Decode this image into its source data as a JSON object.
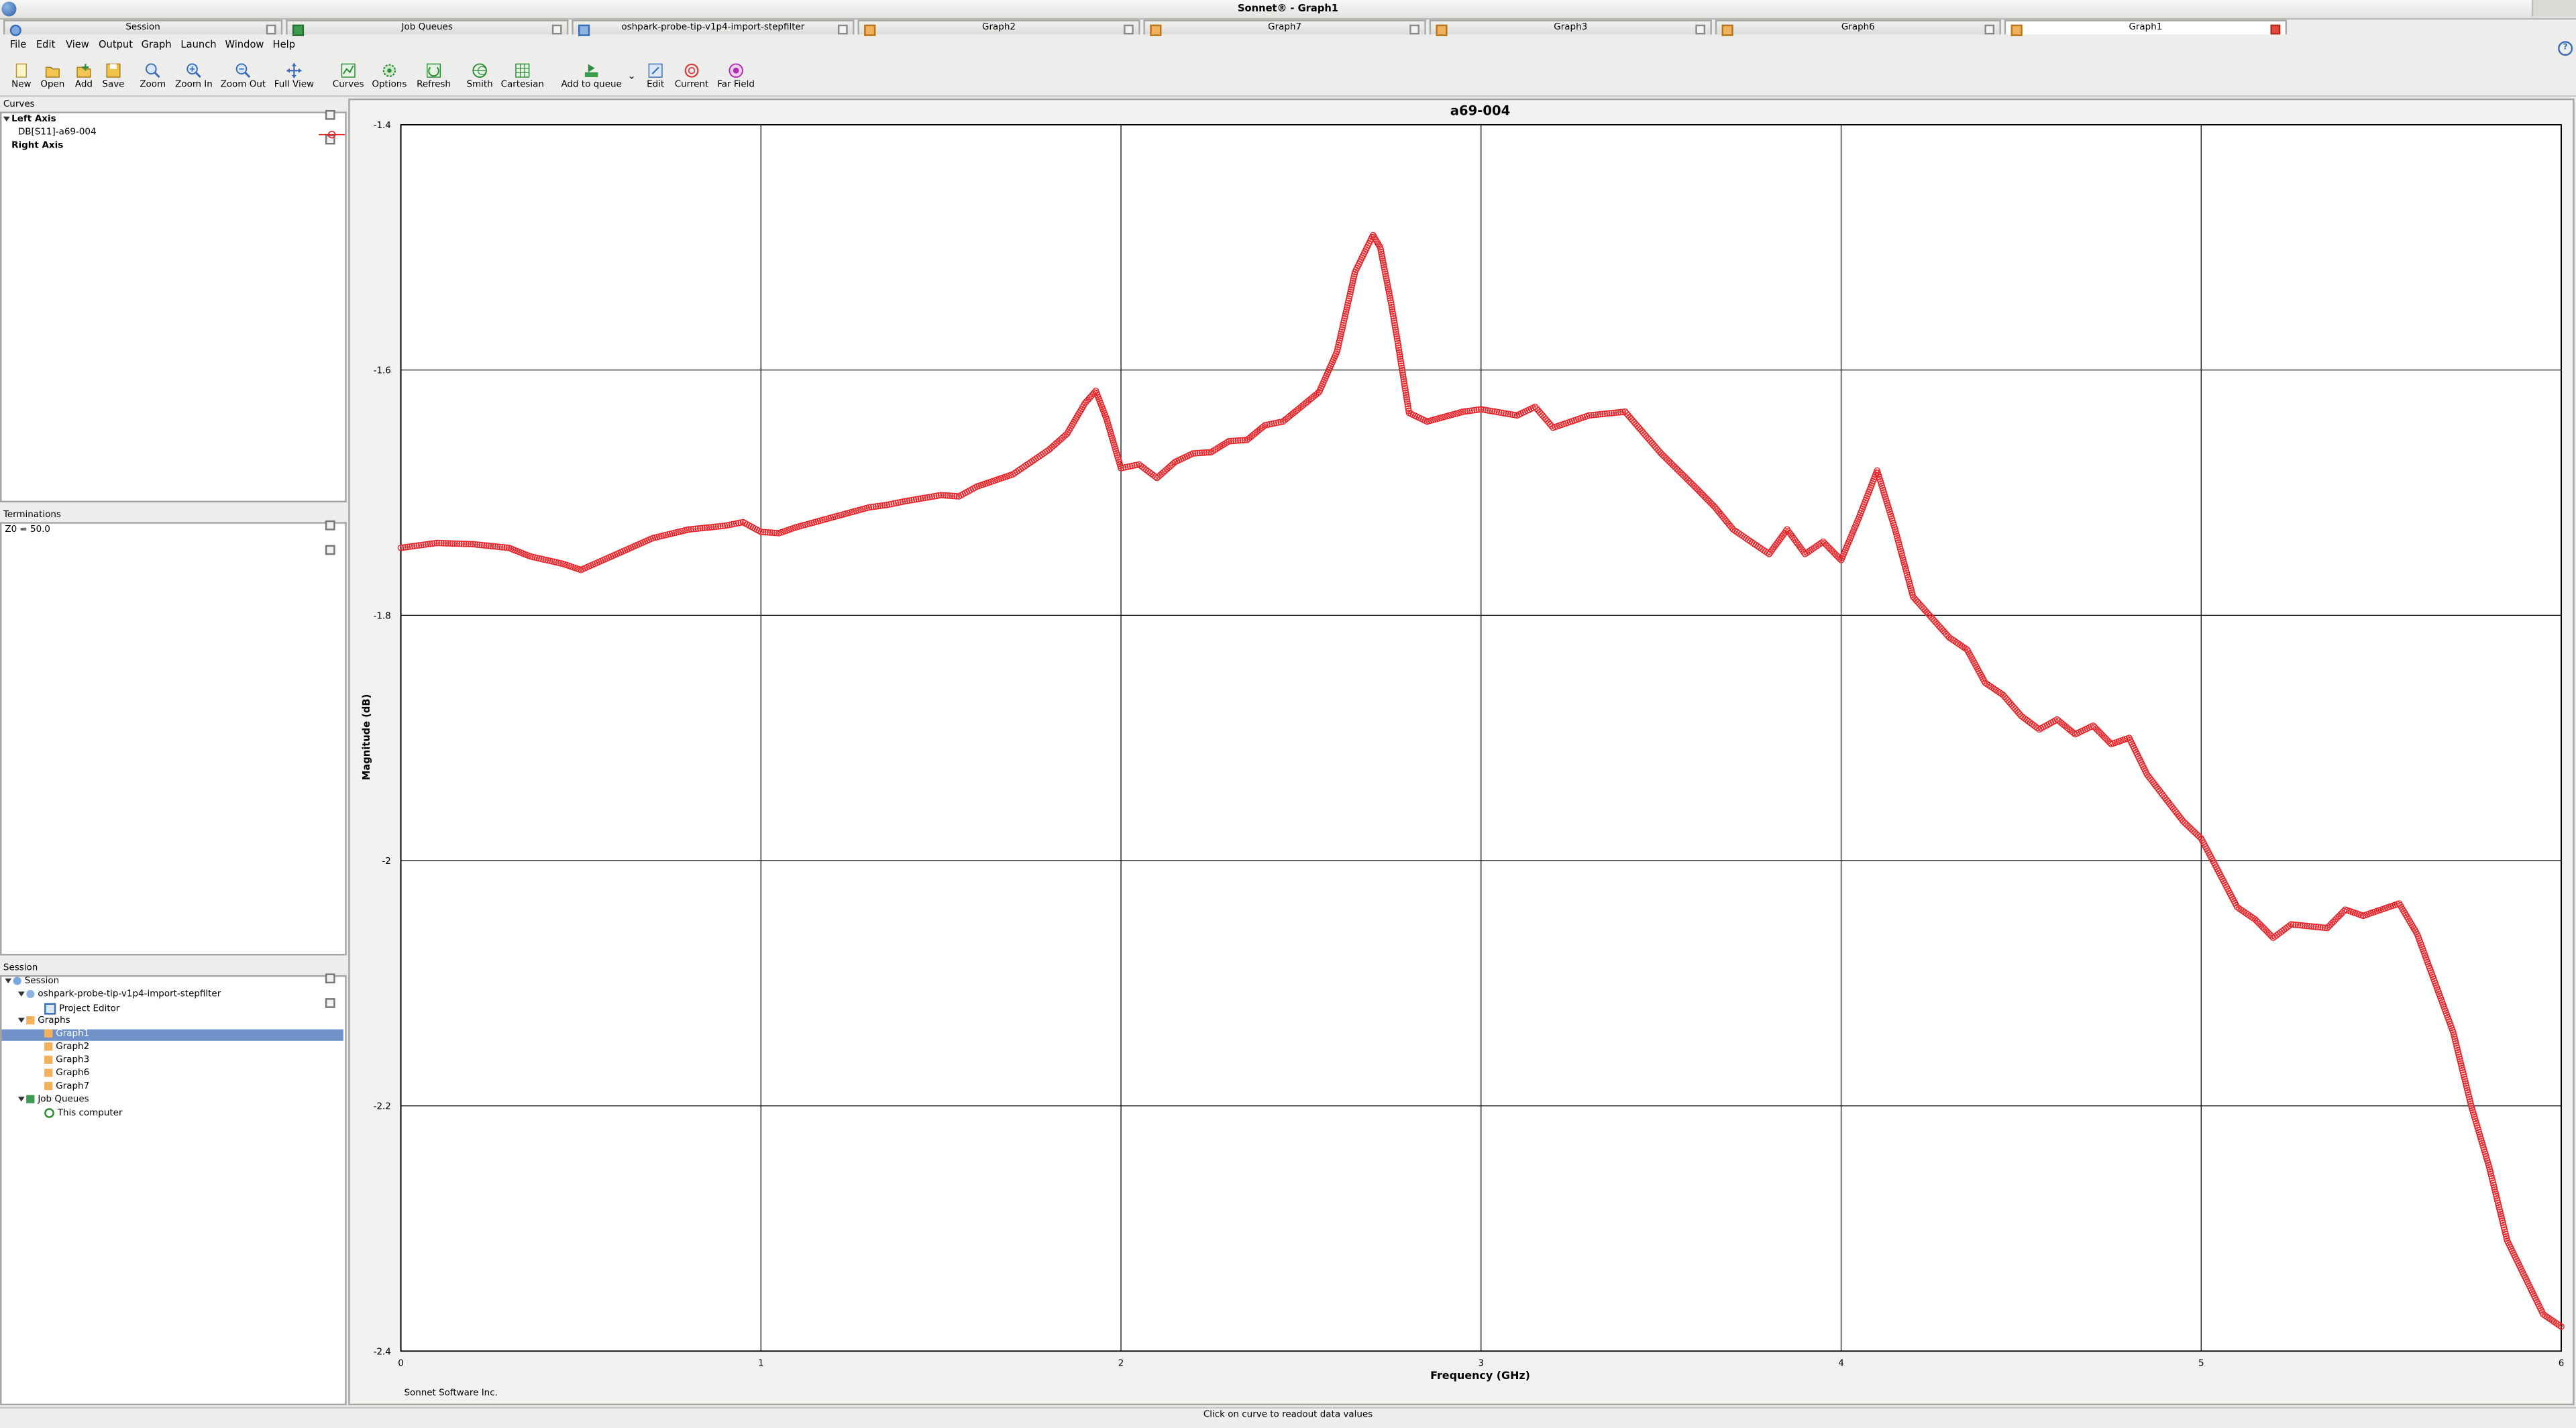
{
  "window": {
    "title": "Sonnet® - Graph1"
  },
  "tabs": [
    {
      "label": "Session",
      "active": false
    },
    {
      "label": "Job Queues",
      "active": false
    },
    {
      "label": "oshpark-probe-tip-v1p4-import-stepfilter",
      "active": false
    },
    {
      "label": "Graph2",
      "active": false
    },
    {
      "label": "Graph7",
      "active": false
    },
    {
      "label": "Graph3",
      "active": false
    },
    {
      "label": "Graph6",
      "active": false
    },
    {
      "label": "Graph1",
      "active": true
    }
  ],
  "menu": [
    "File",
    "Edit",
    "View",
    "Output",
    "Graph",
    "Launch",
    "Window",
    "Help"
  ],
  "toolbar": [
    {
      "label": "New",
      "icon": "new-icon"
    },
    {
      "label": "Open",
      "icon": "open-icon"
    },
    {
      "label": "Add",
      "icon": "add-icon"
    },
    {
      "label": "Save",
      "icon": "save-icon"
    },
    {
      "label": "Zoom",
      "icon": "zoom-icon"
    },
    {
      "label": "Zoom In",
      "icon": "zoom-in-icon"
    },
    {
      "label": "Zoom Out",
      "icon": "zoom-out-icon"
    },
    {
      "label": "Full View",
      "icon": "full-view-icon"
    },
    {
      "label": "Curves",
      "icon": "curves-icon"
    },
    {
      "label": "Options",
      "icon": "options-icon"
    },
    {
      "label": "Refresh",
      "icon": "refresh-icon"
    },
    {
      "label": "Smith",
      "icon": "smith-icon"
    },
    {
      "label": "Cartesian",
      "icon": "cartesian-icon"
    },
    {
      "label": "Add to queue",
      "icon": "add-to-queue-icon"
    },
    {
      "label": "Edit",
      "icon": "edit-icon"
    },
    {
      "label": "Current",
      "icon": "current-icon"
    },
    {
      "label": "Far Field",
      "icon": "far-field-icon"
    }
  ],
  "curves_panel": {
    "title": "Curves",
    "left_axis": "Left Axis",
    "curve": "DB[S11]-a69-004",
    "right_axis": "Right Axis"
  },
  "terminations_panel": {
    "title": "Terminations",
    "value": "Z0 = 50.0"
  },
  "session_panel": {
    "title": "Session",
    "root": "Session",
    "project": "oshpark-probe-tip-v1p4-import-stepfilter",
    "project_editor": "Project Editor",
    "graphs": "Graphs",
    "graph_items": [
      "Graph1",
      "Graph2",
      "Graph3",
      "Graph6",
      "Graph7"
    ],
    "selected": "Graph1",
    "job_queues": "Job Queues",
    "this_computer": "This computer"
  },
  "graph": {
    "footer": "Sonnet Software Inc."
  },
  "status": {
    "text": "Click on curve to readout data values"
  },
  "colors": {
    "curve": "#e8262b",
    "selection": "#7192c8"
  },
  "chart_data": {
    "type": "scatter",
    "title": "a69-004",
    "xlabel": "Frequency (GHz)",
    "ylabel": "Magnitude (dB)",
    "xlim": [
      0,
      6
    ],
    "ylim": [
      -2.4,
      -1.4
    ],
    "xticks": [
      "0",
      "1",
      "2",
      "3",
      "4",
      "5",
      "6"
    ],
    "yticks": [
      "-1.4",
      "-1.6",
      "-1.8",
      "-2",
      "-2.2",
      "-2.4"
    ],
    "grid": true,
    "series": [
      {
        "name": "DB[S11]-a69-004",
        "x": [
          0,
          0.1,
          0.2,
          0.3,
          0.36,
          0.45,
          0.5,
          0.6,
          0.7,
          0.8,
          0.9,
          0.95,
          1.0,
          1.05,
          1.1,
          1.2,
          1.3,
          1.35,
          1.4,
          1.5,
          1.55,
          1.6,
          1.65,
          1.7,
          1.8,
          1.85,
          1.9,
          1.93,
          1.96,
          2.0,
          2.05,
          2.1,
          2.15,
          2.2,
          2.25,
          2.3,
          2.35,
          2.4,
          2.45,
          2.5,
          2.55,
          2.6,
          2.65,
          2.7,
          2.72,
          2.75,
          2.77,
          2.8,
          2.85,
          2.9,
          2.95,
          3.0,
          3.1,
          3.15,
          3.2,
          3.3,
          3.4,
          3.5,
          3.6,
          3.65,
          3.7,
          3.8,
          3.85,
          3.9,
          3.95,
          4.0,
          4.05,
          4.1,
          4.15,
          4.2,
          4.3,
          4.35,
          4.4,
          4.45,
          4.5,
          4.55,
          4.6,
          4.65,
          4.7,
          4.75,
          4.8,
          4.85,
          4.95,
          5.0,
          5.05,
          5.1,
          5.15,
          5.2,
          5.25,
          5.35,
          5.4,
          5.45,
          5.5,
          5.55,
          5.6,
          5.65,
          5.7,
          5.75,
          5.8,
          5.85,
          5.9,
          5.95,
          6.0
        ],
        "y": [
          -1.745,
          -1.741,
          -1.742,
          -1.745,
          -1.752,
          -1.758,
          -1.763,
          -1.75,
          -1.737,
          -1.73,
          -1.727,
          -1.724,
          -1.732,
          -1.733,
          -1.728,
          -1.72,
          -1.712,
          -1.71,
          -1.707,
          -1.702,
          -1.703,
          -1.695,
          -1.69,
          -1.685,
          -1.665,
          -1.652,
          -1.627,
          -1.617,
          -1.64,
          -1.68,
          -1.677,
          -1.688,
          -1.675,
          -1.668,
          -1.667,
          -1.658,
          -1.657,
          -1.645,
          -1.642,
          -1.63,
          -1.618,
          -1.585,
          -1.52,
          -1.49,
          -1.5,
          -1.545,
          -1.58,
          -1.635,
          -1.642,
          -1.638,
          -1.634,
          -1.632,
          -1.637,
          -1.63,
          -1.647,
          -1.637,
          -1.634,
          -1.668,
          -1.697,
          -1.712,
          -1.73,
          -1.75,
          -1.73,
          -1.75,
          -1.74,
          -1.755,
          -1.72,
          -1.682,
          -1.73,
          -1.785,
          -1.818,
          -1.828,
          -1.855,
          -1.865,
          -1.882,
          -1.893,
          -1.885,
          -1.897,
          -1.89,
          -1.905,
          -1.9,
          -1.93,
          -1.968,
          -1.982,
          -2.01,
          -2.038,
          -2.048,
          -2.063,
          -2.052,
          -2.055,
          -2.04,
          -2.045,
          -2.04,
          -2.035,
          -2.06,
          -2.1,
          -2.14,
          -2.2,
          -2.25,
          -2.31,
          -2.34,
          -2.37,
          -2.38
        ]
      }
    ]
  }
}
